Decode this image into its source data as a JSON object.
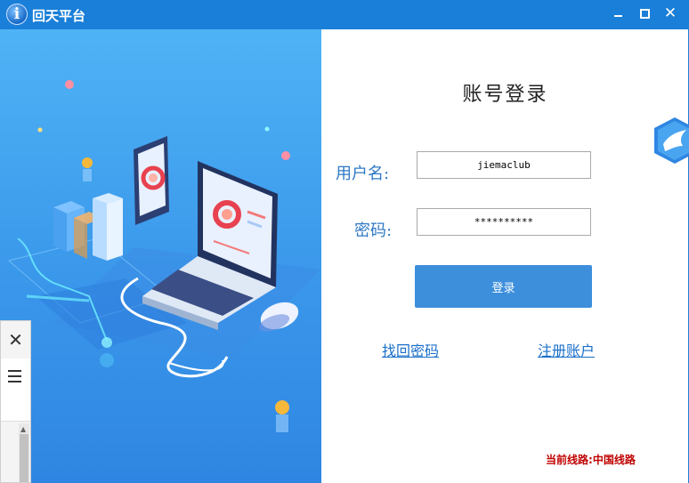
{
  "window": {
    "title": "回天平台",
    "icon": "info-icon",
    "controls": {
      "minimize": "minimize-icon",
      "maximize": "maximize-icon",
      "close": "✕"
    }
  },
  "login": {
    "title": "账号登录",
    "username_label": "用户名:",
    "username_value": "jiemaclub",
    "password_label": "密码:",
    "password_value": "**********",
    "login_button": "登录",
    "forgot_link": "找回密码",
    "register_link": "注册账户",
    "line_label": "当前线路:",
    "line_value": "中国线路"
  },
  "side_widget": {
    "close": "✕"
  },
  "colors": {
    "titlebar": "#1a7fd8",
    "accent": "#3d8fdc",
    "label": "#2e78c4",
    "status": "#c00000"
  }
}
